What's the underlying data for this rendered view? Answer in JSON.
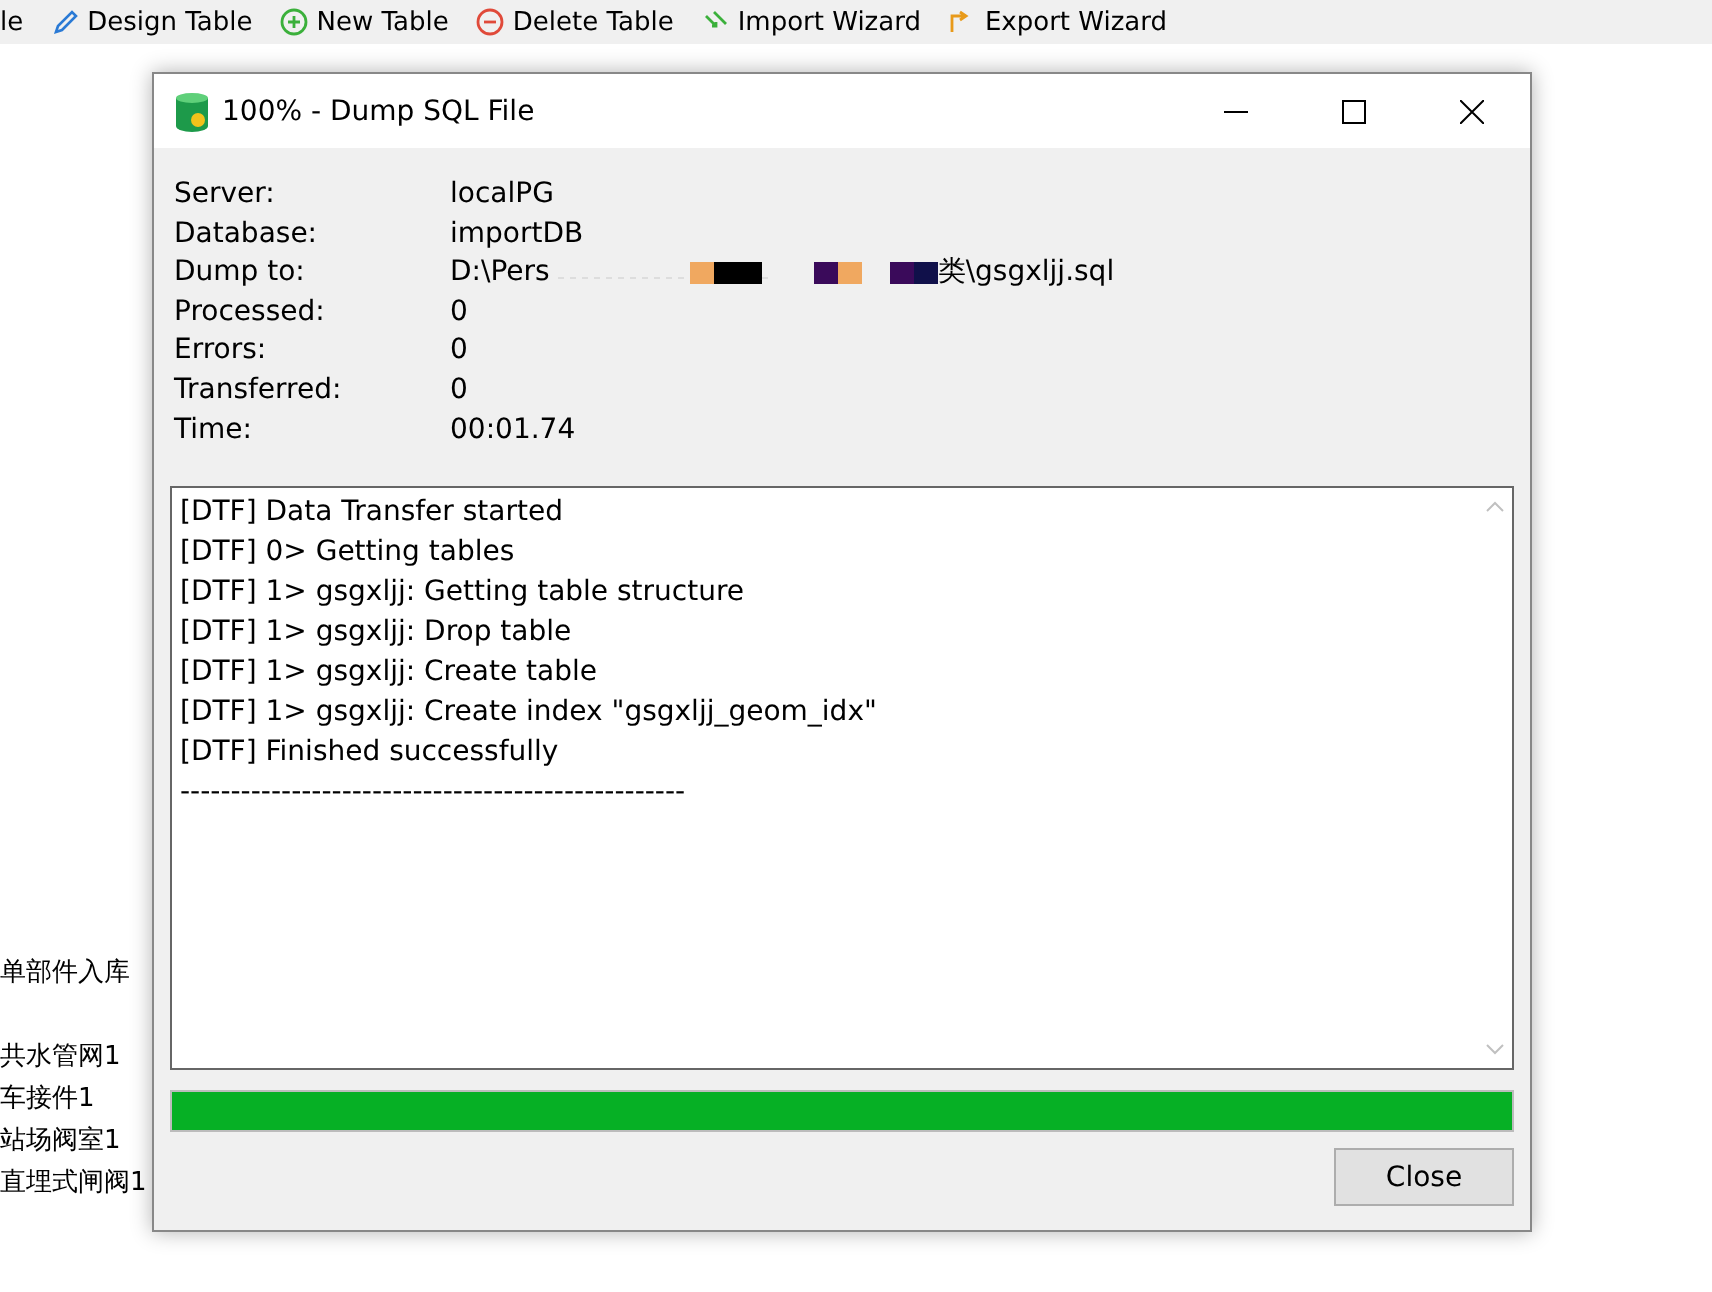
{
  "toolbar": [
    {
      "label": "le",
      "kind": "text"
    },
    {
      "label": "Design Table",
      "kind": "pencil"
    },
    {
      "label": "New Table",
      "kind": "plus"
    },
    {
      "label": "Delete Table",
      "kind": "minus"
    },
    {
      "label": "Import Wizard",
      "kind": "import"
    },
    {
      "label": "Export Wizard",
      "kind": "export"
    }
  ],
  "sidebar": {
    "items": [
      "单部件入库",
      "共水管网1",
      "车接件1",
      "站场阀室1",
      "直埋式闸阀1"
    ]
  },
  "dialog": {
    "title": "100% - Dump SQL File",
    "info": [
      {
        "label": "Server:",
        "value": "localPG"
      },
      {
        "label": "Database:",
        "value": "importDB"
      },
      {
        "label": "Dump to:",
        "value": "D:\\Pers",
        "redacted": true,
        "value_end": "类\\gsgxljj.sql"
      },
      {
        "label": "Processed:",
        "value": "0"
      },
      {
        "label": "Errors:",
        "value": "0"
      },
      {
        "label": "Transferred:",
        "value": "0"
      },
      {
        "label": "Time:",
        "value": "00:01.74"
      }
    ],
    "log": [
      "[DTF] Data Transfer started",
      "[DTF] 0> Getting tables",
      "[DTF] 1> gsgxljj: Getting table structure",
      "[DTF] 1> gsgxljj: Drop table",
      "[DTF] 1> gsgxljj: Create table",
      "[DTF] 1> gsgxljj: Create index \"gsgxljj_geom_idx\"",
      "[DTF] Finished successfully",
      "--------------------------------------------------"
    ],
    "progress": {
      "level": 1
    },
    "buttons": [
      "Close"
    ]
  }
}
